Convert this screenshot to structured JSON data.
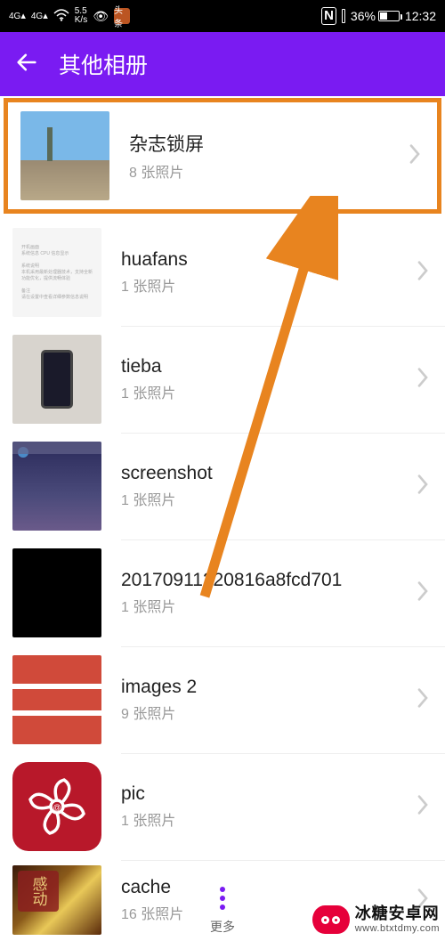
{
  "status_bar": {
    "net1": "4G",
    "net2": "4G",
    "speed_val": "5.5",
    "speed_unit": "K/s",
    "nfc": "N",
    "battery_pct": "36%",
    "time": "12:32"
  },
  "header": {
    "title": "其他相册"
  },
  "albums": [
    {
      "title": "杂志锁屏",
      "count": "8 张照片"
    },
    {
      "title": "huafans",
      "count": "1 张照片"
    },
    {
      "title": "tieba",
      "count": "1 张照片"
    },
    {
      "title": "screenshot",
      "count": "1 张照片"
    },
    {
      "title": "20170911220816a8fcd701",
      "count": "1 张照片"
    },
    {
      "title": "images 2",
      "count": "9 张照片"
    },
    {
      "title": "pic",
      "count": "1 张照片"
    },
    {
      "title": "cache",
      "count": "16 张照片"
    }
  ],
  "bottom": {
    "more": "更多"
  },
  "watermark": {
    "cn": "冰糖安卓网",
    "en": "www.btxtdmy.com"
  },
  "thumb_gold_text": "感动"
}
